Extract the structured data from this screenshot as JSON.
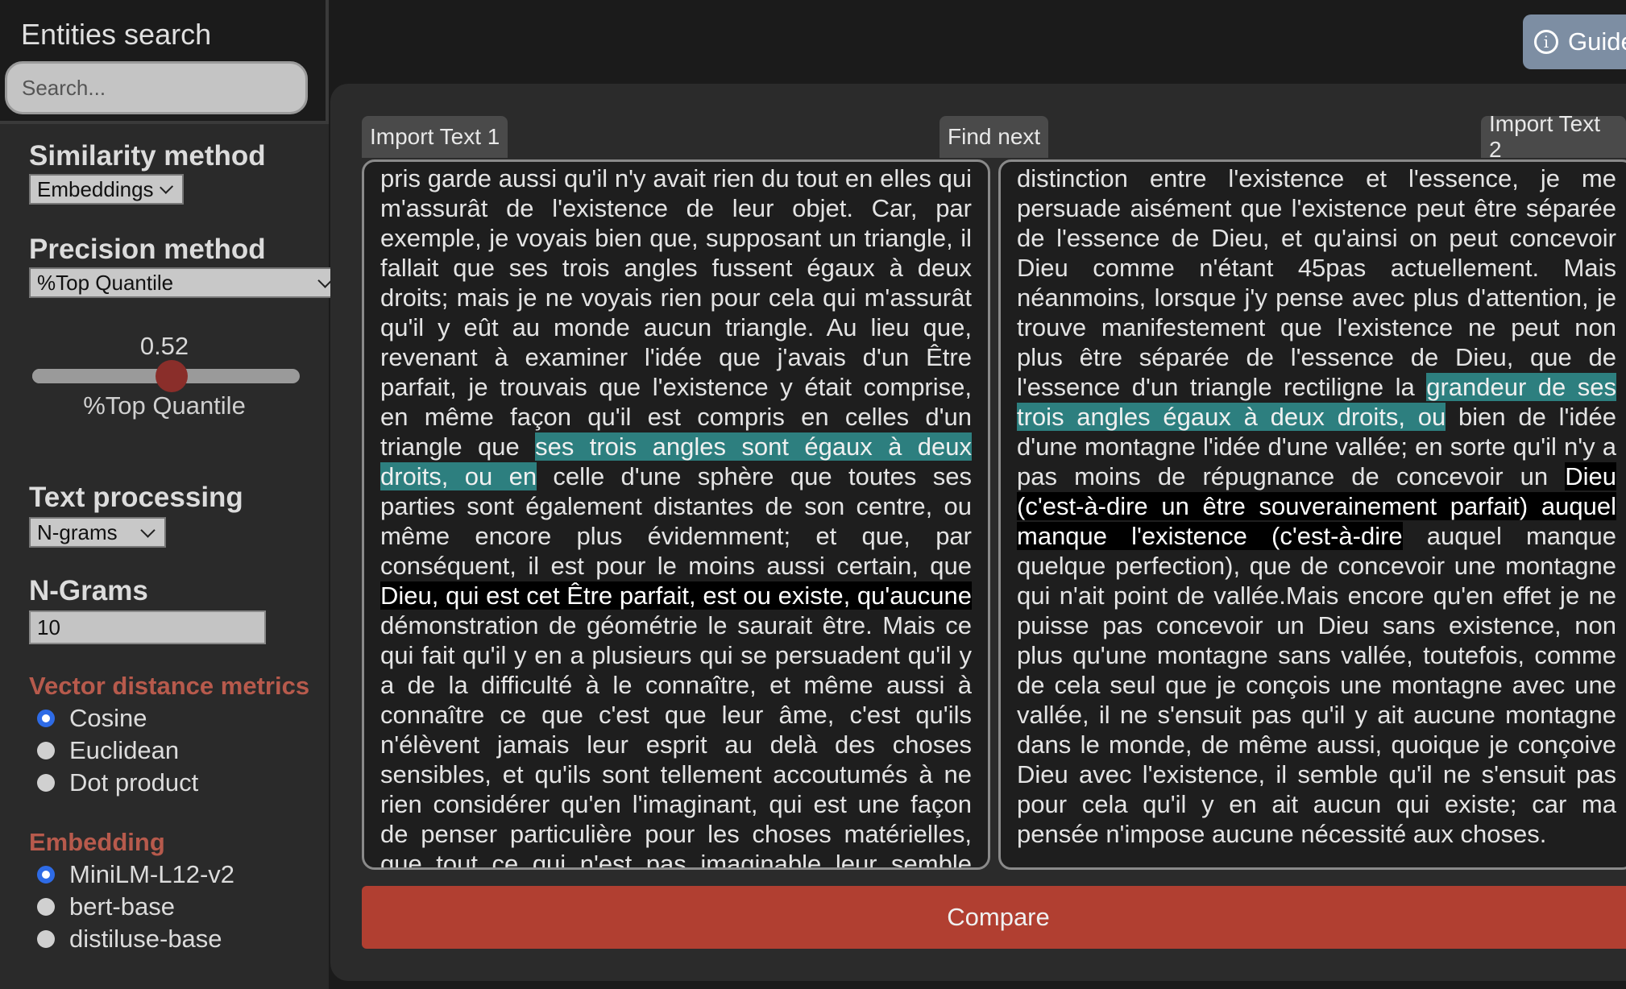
{
  "search": {
    "title": "Entities search",
    "placeholder": "Search..."
  },
  "sidebar": {
    "similarity": {
      "title": "Similarity method",
      "selected": "Embeddings"
    },
    "precision": {
      "title": "Precision method",
      "selected": "%Top Quantile"
    },
    "slider": {
      "value": "0.52",
      "fraction": 0.52,
      "caption": "%Top Quantile"
    },
    "text_processing": {
      "title": "Text processing",
      "selected": "N-grams"
    },
    "ngrams": {
      "title": "N-Grams",
      "value": "10"
    },
    "metrics": {
      "title": "Vector distance metrics",
      "options": [
        "Cosine",
        "Euclidean",
        "Dot product"
      ],
      "selected": "Cosine"
    },
    "embedding": {
      "title": "Embedding",
      "options": [
        "MiniLM-L12-v2",
        "bert-base",
        "distiluse-base"
      ],
      "selected": "MiniLM-L12-v2"
    }
  },
  "guide": {
    "label": "Guide",
    "icon": "info-icon"
  },
  "toolbar": {
    "import1": "Import Text 1",
    "find_next": "Find next",
    "import2": "Import Text 2"
  },
  "text1": {
    "segments": [
      {
        "t": "pris garde aussi qu'il n'y avait rien du tout en elles qui m'assurât de l'existence de leur objet. Car, par exemple, je voyais bien que, supposant un triangle, il fallait que ses trois angles fussent égaux à deux droits; mais je ne voyais rien pour cela qui m'assurât qu'il y eût au monde aucun triangle. Au lieu que, revenant à examiner l'idée que j'avais d'un Être parfait, je trouvais que l'existence y était comprise, en même façon qu'il est compris en celles d'un triangle que ",
        "h": ""
      },
      {
        "t": "ses trois angles sont égaux à deux droits, ou en",
        "h": "teal"
      },
      {
        "t": " celle d'une sphère que toutes ses parties sont également distantes de son centre, ou même encore plus évidemment; et que, par conséquent, il est pour le moins aussi certain, que ",
        "h": ""
      },
      {
        "t": "Dieu, qui est cet Être parfait, est ou existe, qu'aucune",
        "h": "black"
      },
      {
        "t": " démonstration de géométrie le saurait être. Mais ce qui fait qu'il y en a plusieurs qui se persuadent qu'il y a de la difficulté à le connaître, et même aussi à connaître ce que c'est que leur âme, c'est qu'ils n'élèvent jamais leur esprit au delà des choses sensibles, et qu'ils sont tellement accoutumés à ne rien considérer qu'en l'imaginant, qui est une façon de penser particulière pour les choses matérielles, que tout ce qui n'est pas imaginable leur semble n'être pas intelligible.",
        "h": ""
      }
    ]
  },
  "text2": {
    "segments": [
      {
        "t": "distinction entre l'existence et l'essence, je me persuade aisément que l'existence peut être séparée de l'essence de Dieu, et qu'ainsi on peut concevoir Dieu comme n'étant 45pas actuellement. Mais néanmoins, lorsque j'y pense avec plus d'attention, je trouve manifestement que l'existence ne peut non plus être séparée de l'essence de Dieu, que de l'essence d'un triangle rectiligne la ",
        "h": ""
      },
      {
        "t": "grandeur de ses trois angles égaux à deux droits, ou",
        "h": "teal"
      },
      {
        "t": " bien de l'idée d'une montagne l'idée d'une vallée; en sorte qu'il n'y a pas moins de répugnance de concevoir un ",
        "h": ""
      },
      {
        "t": "Dieu (c'est-à-dire un être souverainement parfait) auquel manque l'existence (c'est-à-dire",
        "h": "black"
      },
      {
        "t": " auquel manque quelque perfection), que de concevoir une montagne qui n'ait point de vallée.Mais encore qu'en effet je ne puisse pas concevoir un Dieu sans existence, non plus qu'une montagne sans vallée, toutefois, comme de cela seul que je conçois une montagne avec une vallée, il ne s'ensuit pas qu'il y ait aucune montagne dans le monde, de même aussi, quoique je conçoive Dieu avec l'existence, il semble qu'il ne s'ensuit pas pour cela qu'il y en ait aucun qui existe; car ma pensée n'impose aucune nécessité aux choses.",
        "h": ""
      }
    ]
  },
  "compare": {
    "label": "Compare"
  },
  "colors": {
    "accent": "#b13f31",
    "highlight_match": "#2d7f7f",
    "highlight_entity": "#000000",
    "section_accent": "#b75a4c"
  }
}
